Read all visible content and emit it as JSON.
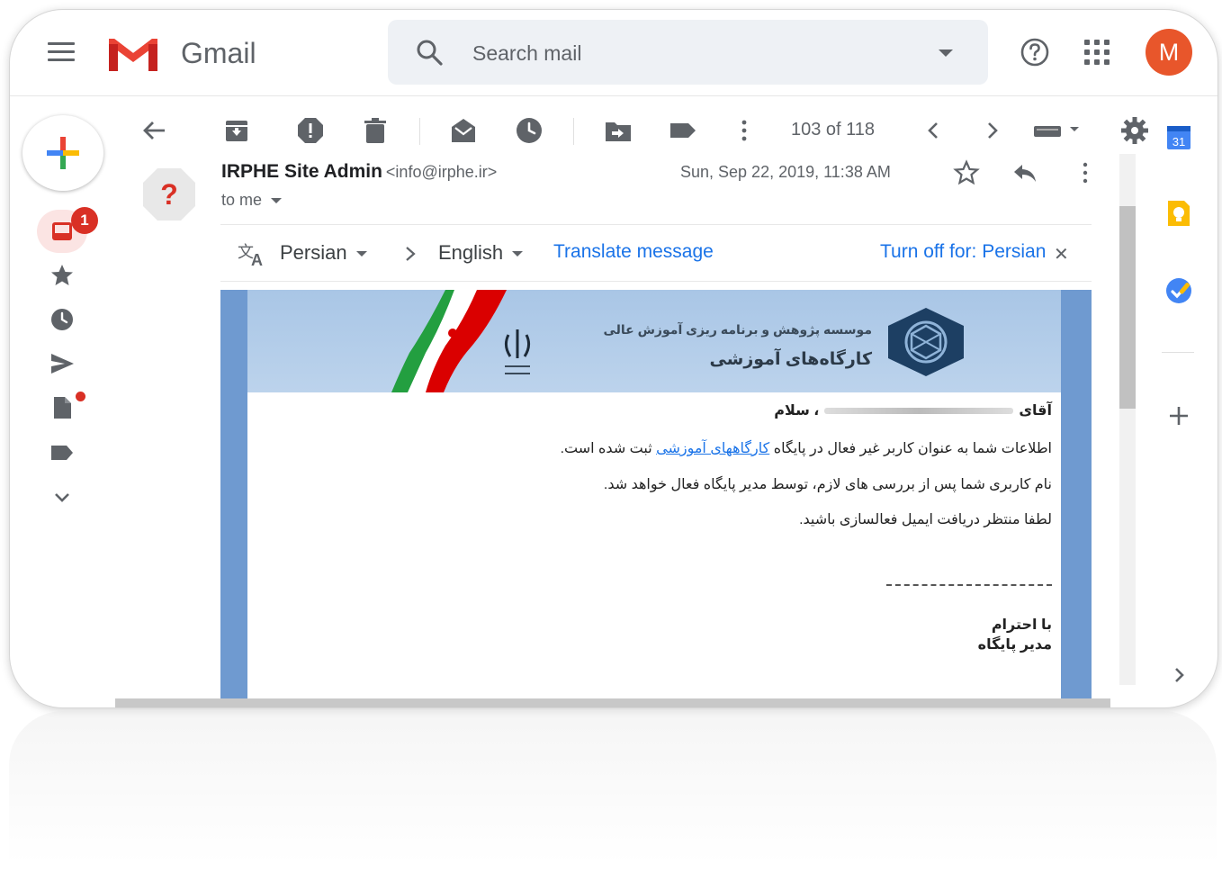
{
  "header": {
    "app_name": "Gmail",
    "search_placeholder": "Search mail",
    "avatar_letter": "M"
  },
  "nav": {
    "inbox_badge": "1"
  },
  "toolbar": {
    "pager": "103 of 118"
  },
  "email": {
    "sender_name": "IRPHE Site Admin",
    "sender_email": "<info@irphe.ir>",
    "to": "to me",
    "date": "Sun, Sep 22, 2019, 11:38 AM",
    "avatar_glyph": "?"
  },
  "translate": {
    "from_lang": "Persian",
    "to_lang": "English",
    "translate_link": "Translate message",
    "turn_off": "Turn off for: Persian",
    "close": "✕"
  },
  "body": {
    "banner_line1": "موسسه پژوهش و برنامه ریزی آموزش عالی",
    "banner_line2": "کارگاه‌های آموزشی",
    "greeting_prefix": "آقای",
    "greeting_suffix": "، سلام",
    "line1_a": "اطلاعات شما به عنوان کاربر غیر فعال در پایگاه",
    "line1_link": "کارگاههای آموزشی",
    "line1_b": "ثبت شده است.",
    "line2": "نام کاربری شما پس از بررسی های لازم، توسط مدیر پایگاه فعال خواهد شد.",
    "line3": "لطفا منتظر دریافت ایمیل فعالسازی باشید.",
    "sign1": "با احترام",
    "sign2": "مدیر پایگاه"
  },
  "side_panel": {
    "calendar_day": "31"
  },
  "colors": {
    "accent": "#1a73e8",
    "avatar": "#e8562b",
    "badge": "#d93025",
    "email_frame": "#6f9ad0"
  }
}
